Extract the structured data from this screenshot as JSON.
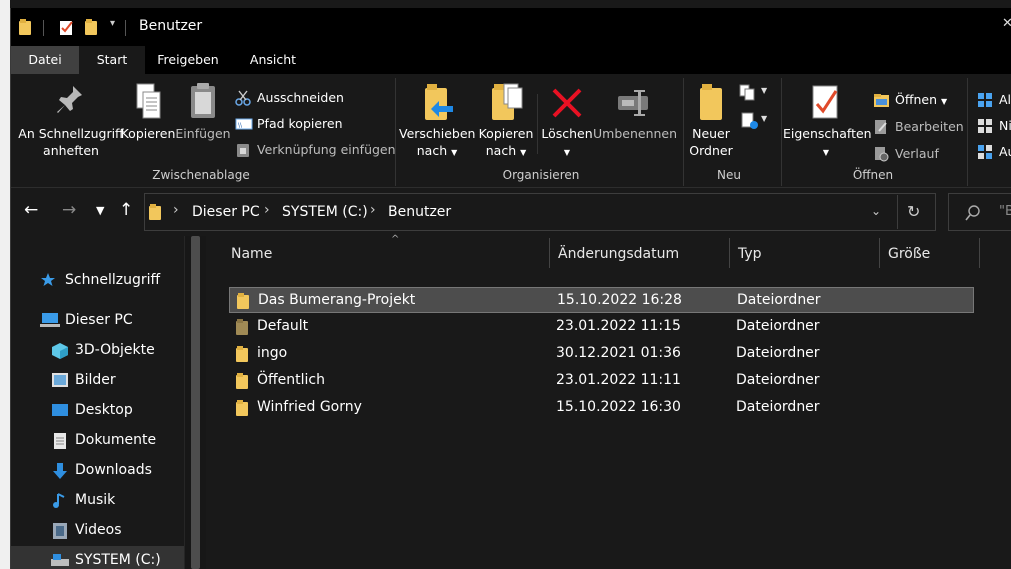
{
  "window": {
    "title": "Benutzer"
  },
  "ribbon_tabs": [
    "Datei",
    "Start",
    "Freigeben",
    "Ansicht"
  ],
  "groups": {
    "clipboard": {
      "label": "Zwischenablage",
      "pin": "An Schnellzugriff\nanheften",
      "pin_l1": "An Schnellzugriff",
      "pin_l2": "anheften",
      "copy": "Kopieren",
      "paste": "Einfügen",
      "cut": "Ausschneiden",
      "copy_path": "Pfad kopieren",
      "paste_shortcut": "Verknüpfung einfügen"
    },
    "organize": {
      "label": "Organisieren",
      "move_l1": "Verschieben",
      "move_l2": "nach",
      "copyto_l1": "Kopieren",
      "copyto_l2": "nach",
      "delete": "Löschen",
      "rename": "Umbenennen"
    },
    "new": {
      "label": "Neu",
      "folder_l1": "Neuer",
      "folder_l2": "Ordner"
    },
    "open": {
      "label": "Öffnen",
      "properties": "Eigenschaften",
      "open": "Öffnen",
      "edit": "Bearbeiten",
      "history": "Verlauf"
    },
    "select": {
      "item1": "All",
      "item2": "Ni",
      "item3": "Au"
    }
  },
  "breadcrumb": [
    "Dieser PC",
    "SYSTEM (C:)",
    "Benutzer"
  ],
  "search": {
    "placeholder": "\"B"
  },
  "nav": {
    "quick": "Schnellzugriff",
    "thispc": "Dieser PC",
    "items": [
      "3D-Objekte",
      "Bilder",
      "Desktop",
      "Dokumente",
      "Downloads",
      "Musik",
      "Videos",
      "SYSTEM (C:)"
    ]
  },
  "columns": {
    "name": "Name",
    "date": "Änderungsdatum",
    "type": "Typ",
    "size": "Größe"
  },
  "files": [
    {
      "name": "Das Bumerang-Projekt",
      "date": "15.10.2022 16:28",
      "type": "Dateiordner"
    },
    {
      "name": "Default",
      "date": "23.01.2022 11:15",
      "type": "Dateiordner"
    },
    {
      "name": "ingo",
      "date": "30.12.2021 01:36",
      "type": "Dateiordner"
    },
    {
      "name": "Öffentlich",
      "date": "23.01.2022 11:11",
      "type": "Dateiordner"
    },
    {
      "name": "Winfried Gorny",
      "date": "15.10.2022 16:30",
      "type": "Dateiordner"
    }
  ],
  "colors": {
    "folder": "#f2c75c",
    "accent": "#0078d7",
    "delete_red": "#e81123",
    "selection": "#4d4d4d"
  }
}
